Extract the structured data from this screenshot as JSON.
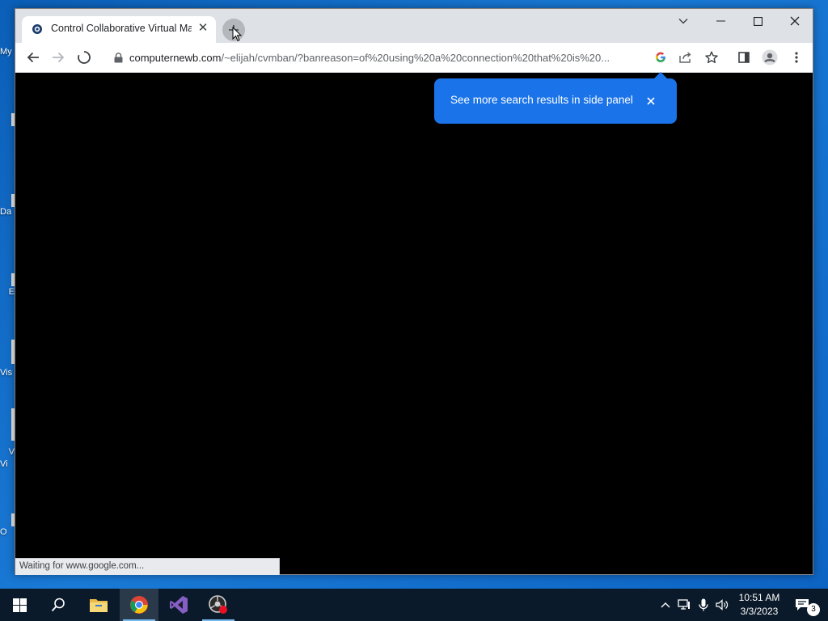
{
  "desktop": {
    "labels": [
      {
        "text": "My"
      },
      {
        "text": "Da"
      },
      {
        "text": "E"
      },
      {
        "text": "Vis"
      },
      {
        "text": "V"
      },
      {
        "text": "Vi"
      },
      {
        "text": "O"
      }
    ]
  },
  "browser": {
    "tab": {
      "title": "Control Collaborative Virtual Ma",
      "close_icon": "close-icon"
    },
    "new_tab_icon": "plus-icon",
    "window_controls": [
      "chevron-down-icon",
      "minimize-icon",
      "maximize-icon",
      "close-icon"
    ],
    "address": {
      "host": "computernewb.com",
      "path": "/~elijah/cvmban/?banreason=of%20using%20a%20connection%20that%20is%20..."
    },
    "toolbar_icons": [
      "back-arrow-icon",
      "forward-arrow-icon",
      "loading-stop-icon",
      "lock-icon",
      "google-lens-icon",
      "share-icon",
      "star-icon",
      "side-panel-icon",
      "profile-icon",
      "more-menu-icon"
    ],
    "bubble": {
      "text": "See more search results in side panel"
    },
    "status_text": "Waiting for www.google.com..."
  },
  "taskbar": {
    "pinned": [
      "windows-start-icon",
      "search-icon",
      "file-explorer-icon",
      "chrome-icon",
      "visual-studio-icon",
      "recording-app-icon"
    ],
    "tray_icons": [
      "chevron-up-icon",
      "network-icon",
      "microphone-icon",
      "volume-icon"
    ],
    "time": "10:51 AM",
    "date": "3/3/2023",
    "notification_count": "3"
  },
  "colors": {
    "desktop_blue": "#1a7ad6",
    "tab_strip": "#dee1e6",
    "bubble_blue": "#1a73e8",
    "taskbar": "#0b1a2a"
  }
}
